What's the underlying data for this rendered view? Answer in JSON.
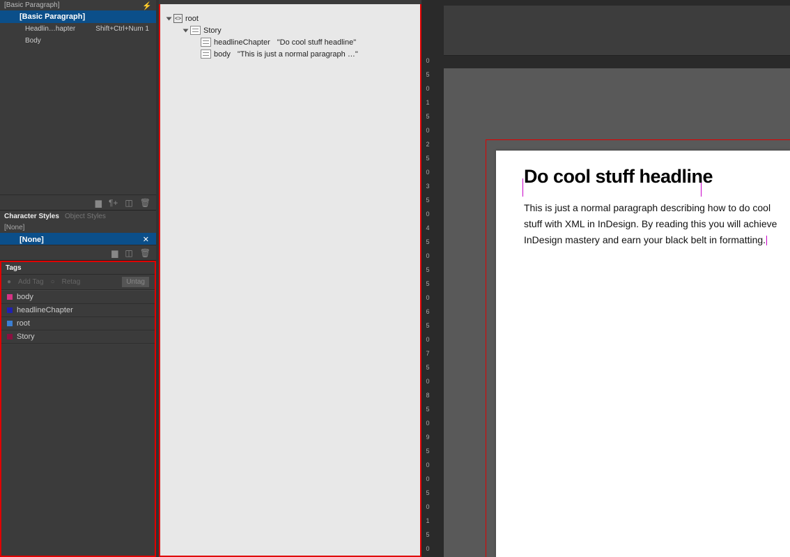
{
  "paragraph_styles": {
    "panel_title": "[Basic Paragraph]",
    "items": [
      {
        "label": "[Basic Paragraph]",
        "shortcut": ""
      },
      {
        "label": "Headlin…hapter",
        "shortcut": "Shift+Ctrl+Num 1"
      },
      {
        "label": "Body",
        "shortcut": ""
      }
    ]
  },
  "char_styles": {
    "tab1": "Character Styles",
    "tab2": "Object Styles",
    "none_label": "[None]",
    "selected": "[None]"
  },
  "tags_panel": {
    "title": "Tags",
    "add_label": "Add Tag",
    "retag_label": "Retag",
    "untag_label": "Untag",
    "items": [
      {
        "label": "body",
        "color": "#d63384"
      },
      {
        "label": "headlineChapter",
        "color": "#2020b0"
      },
      {
        "label": "root",
        "color": "#3b7fd3"
      },
      {
        "label": "Story",
        "color": "#8a1040"
      }
    ]
  },
  "structure": {
    "root_label": "root",
    "story_label": "Story",
    "items": [
      {
        "name": "headlineChapter",
        "preview": "\"Do cool stuff headline\""
      },
      {
        "name": "body",
        "preview": "\"This is just a normal paragraph …\""
      }
    ]
  },
  "document": {
    "headline": "Do cool stuff headline",
    "body": "This is just a normal paragraph describing how to do cool stuff with XML in InDesign. By reading this you will achieve InDesign mastery and earn your black belt in formatting."
  },
  "ruler_v": [
    "0",
    "5",
    "0",
    "1",
    "5",
    "0",
    "2",
    "5",
    "0",
    "3",
    "5",
    "0",
    "4",
    "5",
    "0",
    "5",
    "5",
    "0",
    "6",
    "5",
    "0",
    "7",
    "5",
    "0",
    "8",
    "5",
    "0",
    "9",
    "5",
    "0",
    "0",
    "5",
    "0",
    "1",
    "5",
    "0"
  ]
}
